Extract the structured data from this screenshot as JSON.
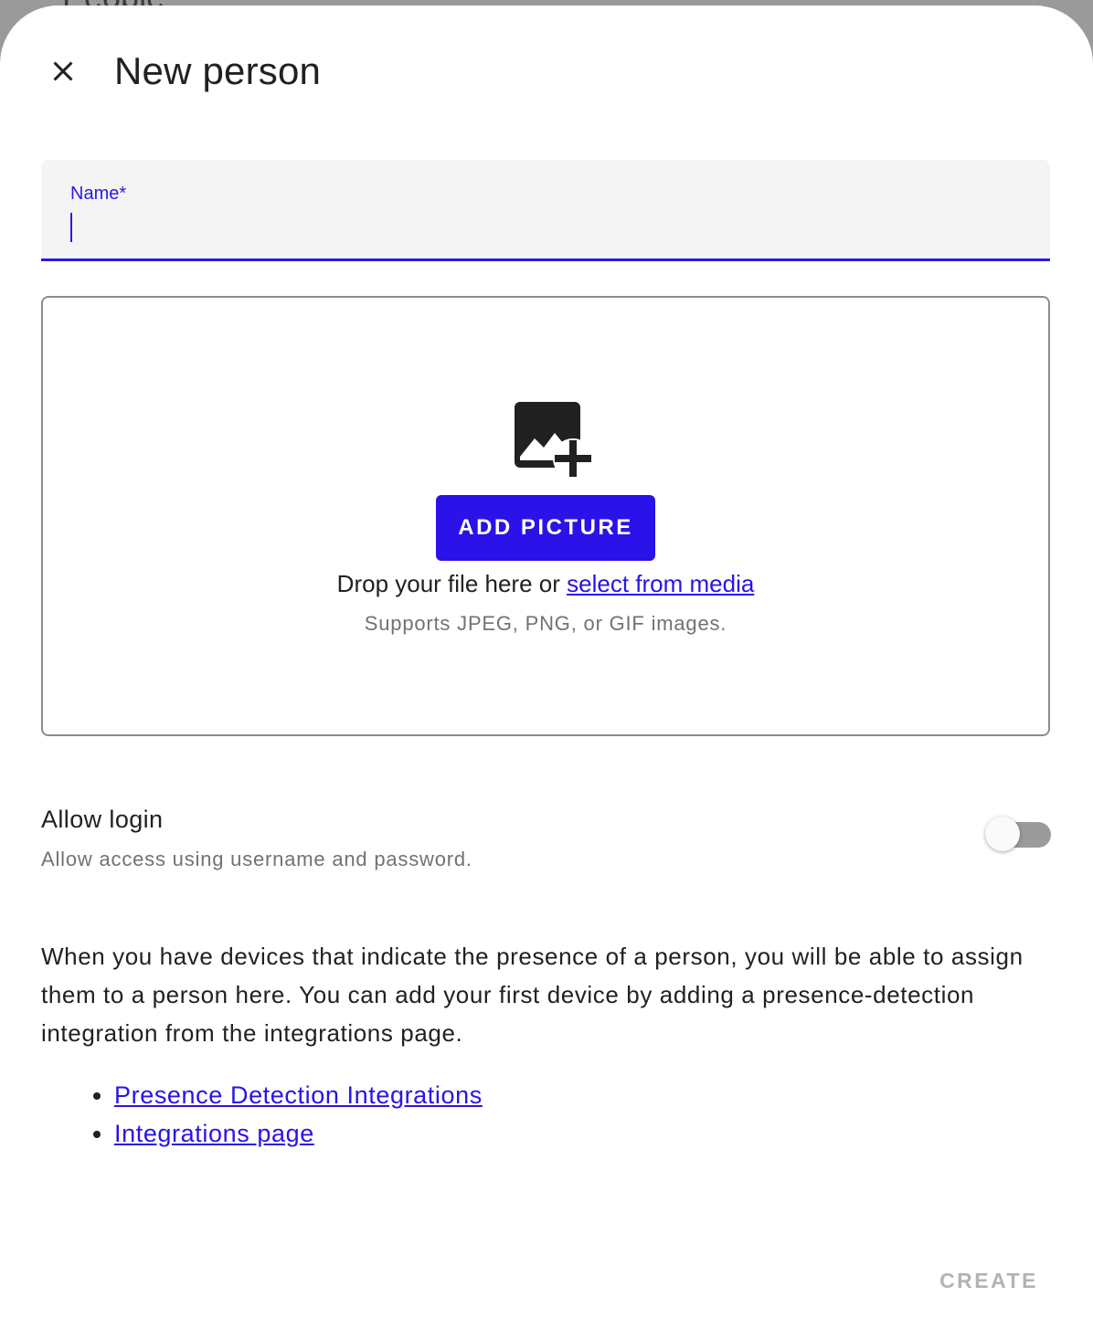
{
  "backdrop": {
    "text": "People"
  },
  "dialog": {
    "title": "New person",
    "close_icon": "close-icon"
  },
  "name_field": {
    "label": "Name*",
    "value": ""
  },
  "picture_upload": {
    "icon": "image-plus-icon",
    "button_label": "ADD PICTURE",
    "drop_text": "Drop your file here or",
    "select_link": "select from media",
    "support_text": "Supports JPEG, PNG, or GIF images."
  },
  "allow_login": {
    "title": "Allow login",
    "subtitle": "Allow access using username and password.",
    "enabled": false
  },
  "info": {
    "text": "When you have devices that indicate the presence of a person, you will be able to assign them to a person here. You can add your first device by adding a presence-detection integration from the integrations page.",
    "links": [
      {
        "label": "Presence Detection Integrations"
      },
      {
        "label": "Integrations page"
      }
    ]
  },
  "actions": {
    "create_label": "CREATE"
  },
  "colors": {
    "accent": "#2a12e8",
    "disabled": "#b3b3b3"
  }
}
